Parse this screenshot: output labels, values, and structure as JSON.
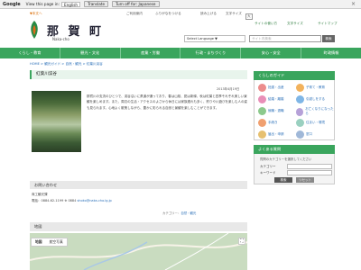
{
  "translate_bar": {
    "brand": "Google",
    "view_label": "View this page in:",
    "language": "English",
    "translate_button": "Translate",
    "turn_off": "Turn off for: Japanese",
    "close": "×"
  },
  "utility": {
    "left_link": "▼本文へ",
    "links": [
      "ご利用案内",
      "ふりがなをつける",
      "読み上げる"
    ],
    "fontsize_label": "文字サイズ",
    "fontsize_options": [
      "小",
      "中",
      "大"
    ]
  },
  "header": {
    "site_name": "那 賀 町",
    "site_sub": "Naka-cho",
    "links": [
      "サイトの使い方",
      "文字サイズ",
      "サイトマップ"
    ],
    "lang_select": "Select Language ▼",
    "search_placeholder": "サイト内検索",
    "search_button": "検索"
  },
  "nav": [
    "くらし・教育",
    "観光・文化",
    "産業・労働",
    "行政・まちづくり",
    "安心・安全",
    "町政情報"
  ],
  "breadcrumb": "HOME > 観光ガイド > 自然・観光 > 紅葉川渓谷",
  "page": {
    "title": "紅葉川渓谷",
    "date": "2013年4月19日",
    "body": "那賀川の支流のひとつで、渓谷沿いに県道が通っており、春は山桜、夏は新緑、秋は紅葉と四季それぞれ美しい景観を楽しめます。また、周辺の生活・アクセスのよさから休日には家族連れも多く、釣りや川遊びを楽しむ人の姿も見られます。心地よく散策しながら、豊かに彩られる自然と景観を楽しむことができます。"
  },
  "contact": {
    "heading": "お問い合わせ",
    "department": "商工観光課",
    "phone": "電話：0884-62-1199 ※ 0884",
    "email": "shoko@naka-cho.lg.jp",
    "category_label": "カテゴリー：",
    "category_value": "自然・観光"
  },
  "map": {
    "heading": "地図",
    "tabs": [
      "地図",
      "航空写真"
    ],
    "fullscreen": "⛶"
  },
  "sidebar": {
    "guide_heading": "くらしのガイド",
    "guide_items": [
      "妊娠・出産",
      "子育て・教育",
      "結婚・離婚",
      "引越しをする",
      "就職・退職",
      "お亡くなりになったら",
      "手続き",
      "住まい・環境",
      "届出・申請",
      "窓口"
    ],
    "faq_heading": "よくある質問",
    "faq_note": "質問のカテゴリーを選択してください",
    "faq_category_label": "カテゴリー",
    "faq_keyword_label": "キーワード",
    "faq_search": "検索",
    "faq_reset": "リセット"
  },
  "colors": {
    "brand_green": "#3aa55d",
    "link_blue": "#2a6fb8"
  }
}
